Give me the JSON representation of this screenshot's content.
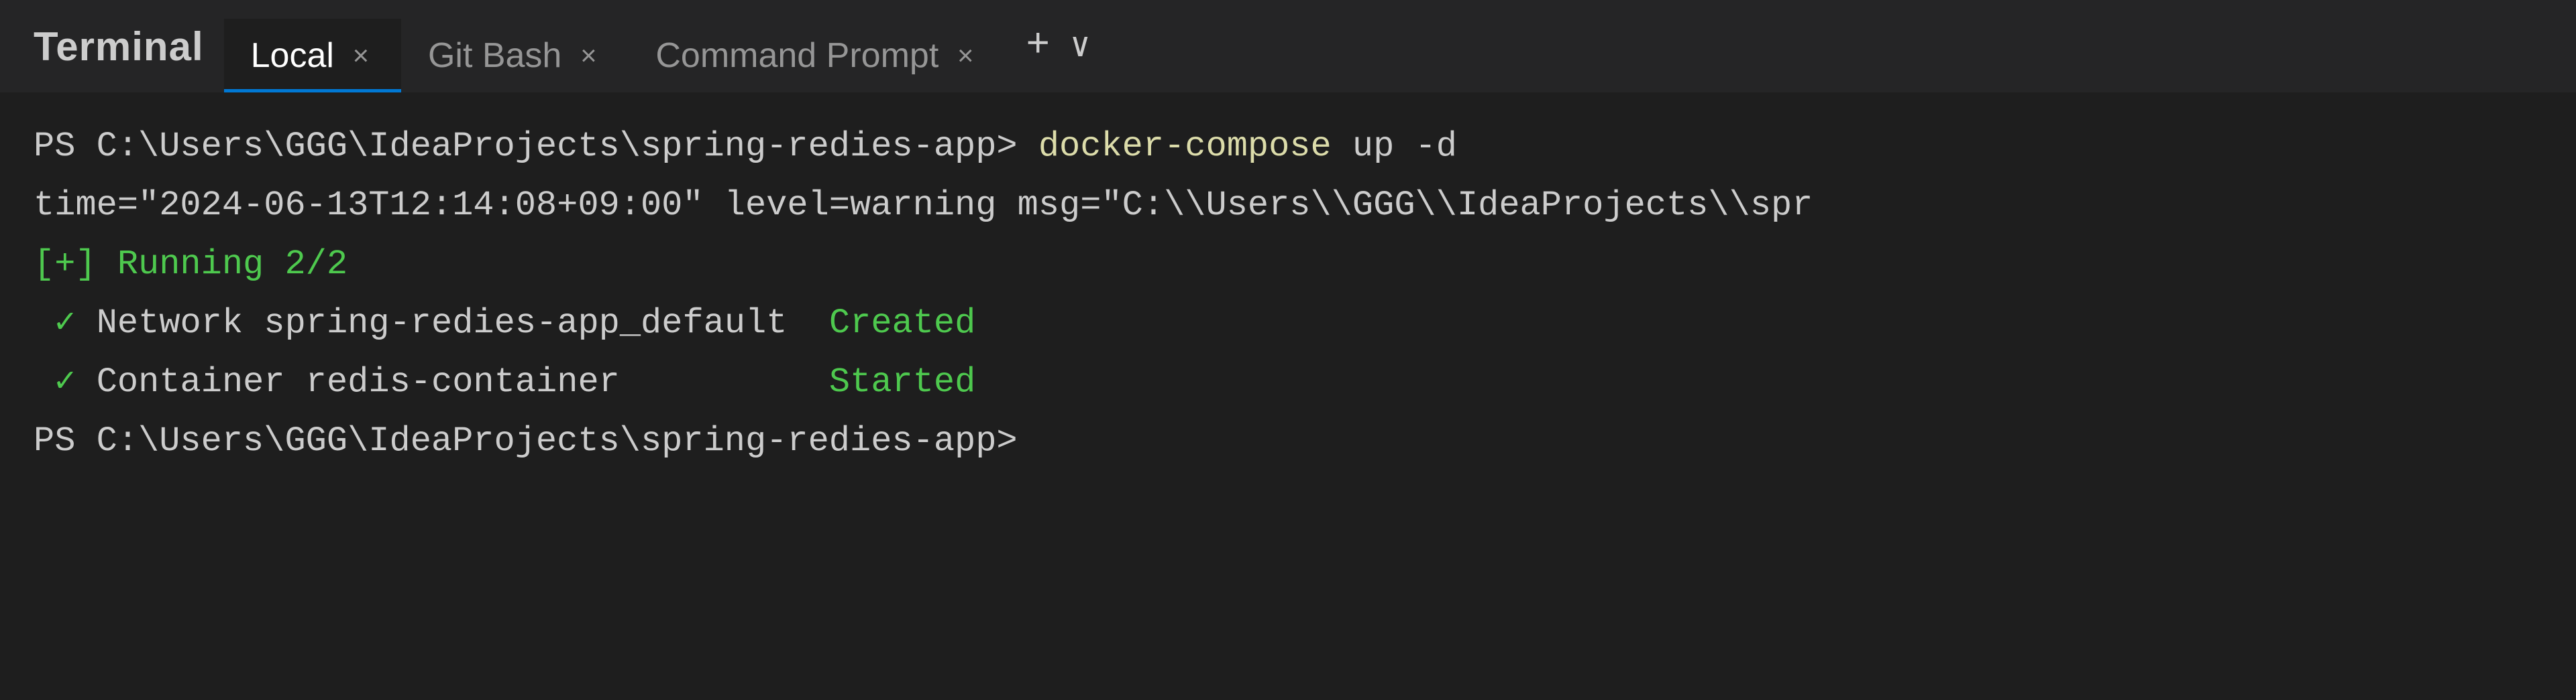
{
  "tabBar": {
    "title": "Terminal",
    "tabs": [
      {
        "label": "Local",
        "active": true,
        "closable": true
      },
      {
        "label": "Git Bash",
        "active": false,
        "closable": true
      },
      {
        "label": "Command Prompt",
        "active": false,
        "closable": true
      }
    ],
    "addButton": "+",
    "dropdownButton": "∨"
  },
  "terminal": {
    "lines": [
      {
        "type": "command",
        "prompt": "PS C:\\Users\\GGG\\IdeaProjects\\spring-redies-app> ",
        "cmdHighlight": "docker-compose",
        "cmdRest": " up -d"
      },
      {
        "type": "warning",
        "text": "time=\"2024-06-13T12:14:08+09:00\" level=warning msg=\"C:\\\\Users\\\\GGG\\\\IdeaProjects\\\\spr"
      },
      {
        "type": "running",
        "text": "[+] Running 2/2"
      },
      {
        "type": "status",
        "check": "✓",
        "label": " Network spring-redies-app_default  ",
        "status": "Created"
      },
      {
        "type": "status",
        "check": "✓",
        "label": " Container redis-container          ",
        "status": "Started"
      },
      {
        "type": "prompt_only",
        "text": "PS C:\\Users\\GGG\\IdeaProjects\\spring-redies-app>"
      }
    ]
  }
}
